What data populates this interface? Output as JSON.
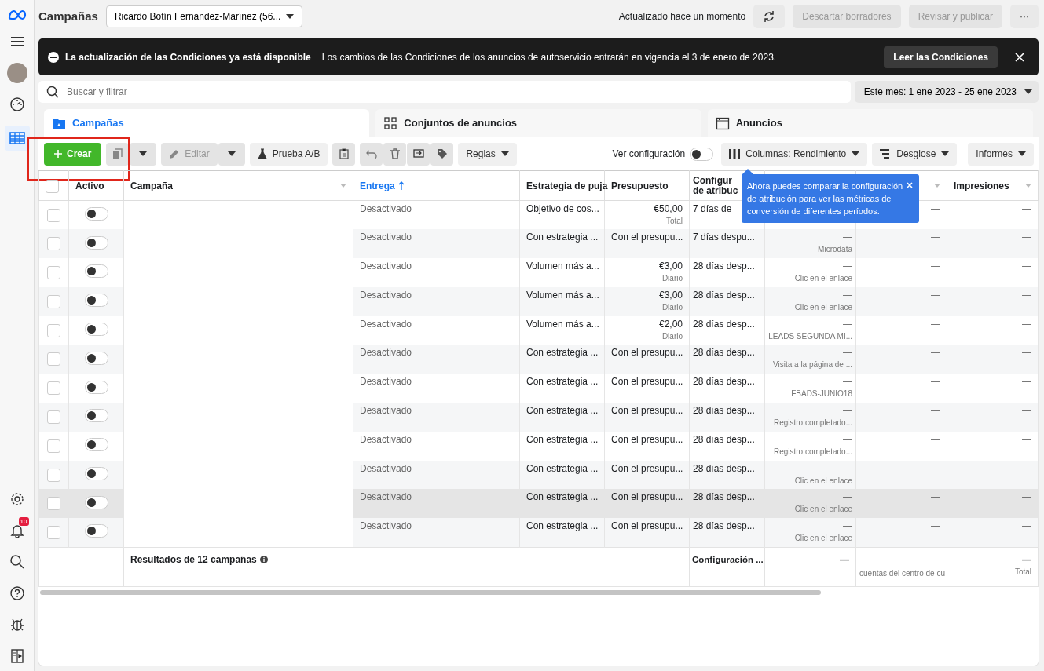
{
  "header": {
    "title": "Campañas",
    "account": "Ricardo Botín Fernández-Maríñez (56...",
    "updated": "Actualizado hace un momento",
    "discard": {
      "label": "Descartar borradores",
      "disabled": true
    },
    "publish": {
      "label": "Revisar y publicar",
      "disabled": true
    },
    "more": "···"
  },
  "sidebar": {
    "top": [
      {
        "kind": "menu"
      },
      {
        "kind": "avatar"
      },
      {
        "kind": "gauge"
      },
      {
        "kind": "table",
        "selected": true
      }
    ],
    "bottom": [
      {
        "kind": "settings"
      },
      {
        "kind": "bell",
        "badge": "10"
      },
      {
        "kind": "search"
      },
      {
        "kind": "help"
      },
      {
        "kind": "bug"
      },
      {
        "kind": "panel"
      }
    ]
  },
  "banner": {
    "title": "La actualización de las Condiciones ya está disponible",
    "text": "Los cambios de las Condiciones de los anuncios de autoservicio entrarán en vigencia el 3 de enero de 2023.",
    "button": "Leer las Condiciones"
  },
  "search": {
    "placeholder": "Buscar y filtrar"
  },
  "date_range": "Este mes: 1 ene 2023 - 25 ene 2023",
  "tabs": [
    {
      "label": "Campañas",
      "kind": "folder",
      "selected": true
    },
    {
      "label": "Conjuntos de anuncios",
      "kind": "grid",
      "selected": false
    },
    {
      "label": "Anuncios",
      "kind": "window",
      "selected": false
    }
  ],
  "toolbar": {
    "create": "Crear",
    "edit": {
      "label": "Editar",
      "disabled": true
    },
    "ab_test": "Prueba A/B",
    "rules": "Reglas",
    "view_settings": {
      "label": "Ver configuración",
      "on": false
    },
    "columns": "Columnas: Rendimiento",
    "breakdown": "Desglose",
    "reports": "Informes"
  },
  "tooltip": "Ahora puedes comparar la configuración de atribución para ver las métricas de conversión de diferentes períodos.",
  "table": {
    "header_checked": false,
    "columns": [
      {
        "kind": "checkbox"
      },
      {
        "label": "Activo"
      },
      {
        "label": "Campaña",
        "menu": true
      },
      {
        "label": "Entrega",
        "sorted": true
      },
      {
        "label": "Estrategia de puja"
      },
      {
        "label": "Presupuesto"
      },
      {
        "label": "Configur de atribuc",
        "kind": "narrow"
      },
      {
        "kind": "blank"
      },
      {
        "kind": "blank",
        "menu": true
      },
      {
        "label": "Impresiones",
        "menu": true
      }
    ],
    "rows": [
      {
        "checked": false,
        "active": false,
        "hovered": false,
        "delivery": "Desactivado",
        "bid_strategy": "Objetivo de cos...",
        "budget": "€50,00",
        "budget_type": "Total",
        "attribution": "7 días de",
        "column_9": "—",
        "impressions": "—"
      },
      {
        "checked": false,
        "active": false,
        "hovered": false,
        "delivery": "Desactivado",
        "bid_strategy": "Con estrategia ...",
        "budget": "Con el presupu...",
        "attribution": "7 días despu...",
        "column_8": "—",
        "column_8_sub": "Microdata",
        "column_9": "—",
        "impressions": "—"
      },
      {
        "checked": false,
        "active": false,
        "hovered": false,
        "delivery": "Desactivado",
        "bid_strategy": "Volumen más a...",
        "budget": "€3,00",
        "budget_type": "Diario",
        "attribution": "28 días desp...",
        "column_8": "—",
        "column_8_sub": "Clic en el enlace",
        "column_9": "—",
        "impressions": "—"
      },
      {
        "checked": false,
        "active": false,
        "hovered": false,
        "delivery": "Desactivado",
        "bid_strategy": "Volumen más a...",
        "budget": "€3,00",
        "budget_type": "Diario",
        "attribution": "28 días desp...",
        "column_8": "—",
        "column_8_sub": "Clic en el enlace",
        "column_9": "—",
        "impressions": "—"
      },
      {
        "checked": false,
        "active": false,
        "hovered": false,
        "delivery": "Desactivado",
        "bid_strategy": "Volumen más a...",
        "budget": "€2,00",
        "budget_type": "Diario",
        "attribution": "28 días desp...",
        "column_8": "—",
        "column_8_sub": "LEADS SEGUNDA MI...",
        "column_9": "—",
        "impressions": "—"
      },
      {
        "checked": false,
        "active": false,
        "hovered": false,
        "delivery": "Desactivado",
        "bid_strategy": "Con estrategia ...",
        "budget": "Con el presupu...",
        "attribution": "28 días desp...",
        "column_8": "—",
        "column_8_sub": "Visita a la página de ...",
        "column_9": "—",
        "impressions": "—"
      },
      {
        "checked": false,
        "active": false,
        "hovered": false,
        "delivery": "Desactivado",
        "bid_strategy": "Con estrategia ...",
        "budget": "Con el presupu...",
        "attribution": "28 días desp...",
        "column_8": "—",
        "column_8_sub": "FBADS-JUNIO18",
        "column_9": "—",
        "impressions": "—"
      },
      {
        "checked": false,
        "active": false,
        "hovered": false,
        "delivery": "Desactivado",
        "bid_strategy": "Con estrategia ...",
        "budget": "Con el presupu...",
        "attribution": "28 días desp...",
        "column_8": "—",
        "column_8_sub": "Registro completado...",
        "column_9": "—",
        "impressions": "—"
      },
      {
        "checked": false,
        "active": false,
        "hovered": false,
        "delivery": "Desactivado",
        "bid_strategy": "Con estrategia ...",
        "budget": "Con el presupu...",
        "attribution": "28 días desp...",
        "column_8": "—",
        "column_8_sub": "Registro completado...",
        "column_9": "—",
        "impressions": "—"
      },
      {
        "checked": false,
        "active": false,
        "hovered": false,
        "delivery": "Desactivado",
        "bid_strategy": "Con estrategia ...",
        "budget": "Con el presupu...",
        "attribution": "28 días desp...",
        "column_8": "—",
        "column_8_sub": "Clic en el enlace",
        "column_9": "—",
        "impressions": "—"
      },
      {
        "checked": false,
        "active": false,
        "hovered": true,
        "delivery": "Desactivado",
        "bid_strategy": "Con estrategia ...",
        "budget": "Con el presupu...",
        "attribution": "28 días desp...",
        "column_8": "—",
        "column_8_sub": "Clic en el enlace",
        "column_9": "—",
        "impressions": "—"
      },
      {
        "checked": false,
        "active": false,
        "hovered": false,
        "delivery": "Desactivado",
        "bid_strategy": "Con estrategia ...",
        "budget": "Con el presupu...",
        "attribution": "28 días desp...",
        "column_8": "—",
        "column_8_sub": "Clic en el enlace",
        "column_9": "—",
        "impressions": "—"
      }
    ],
    "footer": {
      "results": "Resultados de 12 campañas",
      "attribution": "Configuración ...",
      "column_8": "—",
      "column_9_sub": "cuentas del centro de cu",
      "impressions": "—",
      "impressions_sub": "Total"
    }
  }
}
